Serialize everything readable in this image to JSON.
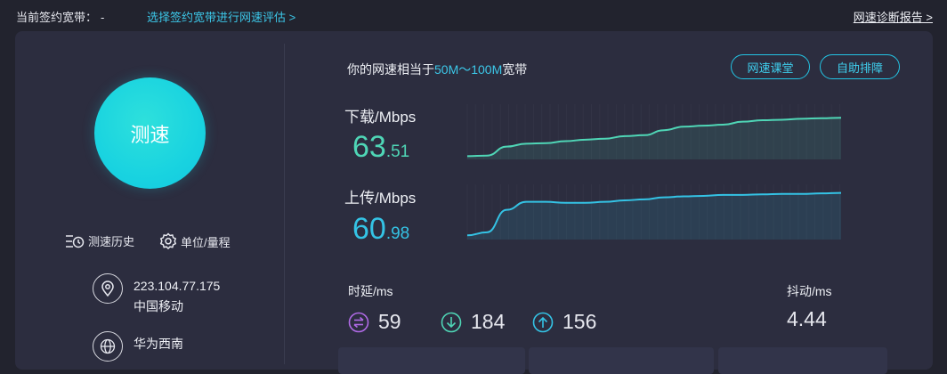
{
  "topbar": {
    "bandwidth_label": "当前签约宽带：",
    "bandwidth_value": "-",
    "evaluate_link": "选择签约宽带进行网速评估 >",
    "report_link": "网速诊断报告 >"
  },
  "left": {
    "speed_button": "测速",
    "history_label": "测速历史",
    "units_label": "单位/量程",
    "ip_address": "223.104.77.175",
    "isp": "中国移动",
    "server": "华为西南"
  },
  "result": {
    "summary_prefix": "你的网速相当于",
    "summary_range": "50M～100M",
    "summary_suffix": "宽带",
    "course_button": "网速课堂",
    "selfhelp_button": "自助排障"
  },
  "download": {
    "label": "下载/Mbps",
    "value_int": "63",
    "value_dec": ".51",
    "color": "#4fd6b6",
    "curve": [
      0.03,
      0.04,
      0.22,
      0.28,
      0.29,
      0.33,
      0.36,
      0.38,
      0.43,
      0.45,
      0.55,
      0.62,
      0.64,
      0.66,
      0.72,
      0.75,
      0.76,
      0.78,
      0.79,
      0.8
    ]
  },
  "upload": {
    "label": "上传/Mbps",
    "value_int": "60",
    "value_dec": ".98",
    "color": "#34c3e5",
    "curve": [
      0.05,
      0.11,
      0.56,
      0.72,
      0.72,
      0.7,
      0.7,
      0.72,
      0.75,
      0.77,
      0.81,
      0.83,
      0.84,
      0.86,
      0.86,
      0.87,
      0.88,
      0.88,
      0.89,
      0.9
    ]
  },
  "latency": {
    "label": "时延/ms",
    "items": [
      {
        "value": "59",
        "color": "#b06ae6"
      },
      {
        "value": "184",
        "color": "#4fd6b6"
      },
      {
        "value": "156",
        "color": "#34c3e5"
      }
    ]
  },
  "jitter": {
    "label": "抖动/ms",
    "value": "4.44"
  }
}
